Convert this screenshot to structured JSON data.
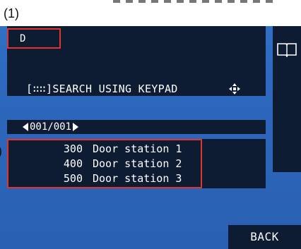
{
  "callouts": {
    "label_1": "(1)",
    "label_2": ")"
  },
  "search": {
    "input_value": "D",
    "keypad_hint": "[∷∷]SEARCH USING KEYPAD"
  },
  "icons": {
    "move": "four-way-arrow-icon",
    "phonebook": "open-book-icon"
  },
  "pager": {
    "text": "001/001"
  },
  "results": [
    {
      "number": "300",
      "name": "Door station 1"
    },
    {
      "number": "400",
      "name": "Door station 2"
    },
    {
      "number": "500",
      "name": "Door station 3"
    }
  ],
  "buttons": {
    "back_label": "BACK"
  },
  "colors": {
    "screen_blue": "#2c66bb",
    "panel_dark": "#0d1b33",
    "highlight_red": "#e0342b"
  }
}
